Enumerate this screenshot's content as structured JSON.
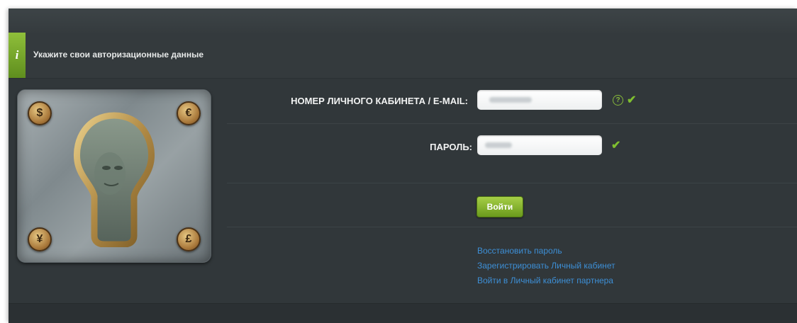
{
  "info": {
    "icon": "info-icon",
    "icon_glyph": "i",
    "message": "Укажите свои авторизационные данные",
    "accent_color": "#7fae2c"
  },
  "illustration": {
    "coins": [
      {
        "name": "dollar-coin-icon",
        "symbol": "$"
      },
      {
        "name": "euro-coin-icon",
        "symbol": "€"
      },
      {
        "name": "yen-coin-icon",
        "symbol": "¥"
      },
      {
        "name": "pound-coin-icon",
        "symbol": "£"
      }
    ]
  },
  "form": {
    "account_label": "НОМЕР ЛИЧНОГО КАБИНЕТА / E-MAIL:",
    "account_value": "",
    "help_glyph": "?",
    "check_glyph": "✔",
    "password_label": "ПАРОЛЬ:",
    "password_value": "",
    "submit_label": "Войти"
  },
  "links": {
    "restore_password": "Восстановить пароль",
    "register": "Зарегистрировать Личный кабинет",
    "partner_login": "Войти в Личный кабинет партнера"
  },
  "colors": {
    "panel_bg": "#31373a",
    "link": "#3d8fd6",
    "button": "#8ab834",
    "check": "#7fbf2f"
  }
}
